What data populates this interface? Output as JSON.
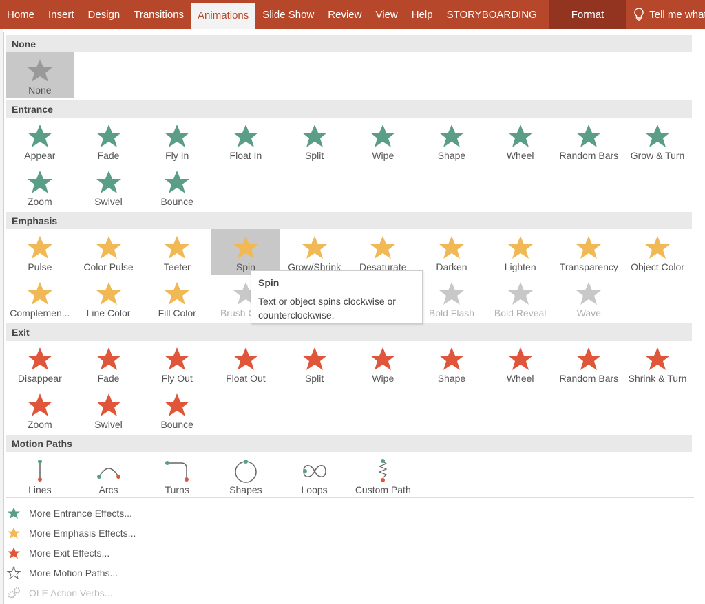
{
  "ribbon": {
    "tabs": [
      "Home",
      "Insert",
      "Design",
      "Transitions",
      "Animations",
      "Slide Show",
      "Review",
      "View",
      "Help",
      "STORYBOARDING"
    ],
    "active": "Animations",
    "format": "Format",
    "tell_me": "Tell me what",
    "color": "#b7472a"
  },
  "colors": {
    "none": "#999999",
    "entrance": "#5a9e87",
    "emphasis": "#f0b956",
    "exit": "#e0563b",
    "disabled": "#c8c8c8"
  },
  "sections": [
    {
      "title": "None",
      "kind": "none",
      "items": [
        {
          "label": "None",
          "selected": true
        }
      ]
    },
    {
      "title": "Entrance",
      "kind": "entrance",
      "items": [
        {
          "label": "Appear"
        },
        {
          "label": "Fade"
        },
        {
          "label": "Fly In"
        },
        {
          "label": "Float In"
        },
        {
          "label": "Split"
        },
        {
          "label": "Wipe"
        },
        {
          "label": "Shape"
        },
        {
          "label": "Wheel"
        },
        {
          "label": "Random Bars"
        },
        {
          "label": "Grow & Turn"
        },
        {
          "label": "Zoom"
        },
        {
          "label": "Swivel"
        },
        {
          "label": "Bounce"
        }
      ]
    },
    {
      "title": "Emphasis",
      "kind": "emphasis",
      "items": [
        {
          "label": "Pulse"
        },
        {
          "label": "Color Pulse"
        },
        {
          "label": "Teeter"
        },
        {
          "label": "Spin",
          "selected": true
        },
        {
          "label": "Grow/Shrink"
        },
        {
          "label": "Desaturate"
        },
        {
          "label": "Darken"
        },
        {
          "label": "Lighten"
        },
        {
          "label": "Transparency"
        },
        {
          "label": "Object Color"
        },
        {
          "label": "Complemen..."
        },
        {
          "label": "Line Color"
        },
        {
          "label": "Fill Color"
        },
        {
          "label": "Brush Color",
          "disabled": true
        },
        {
          "label": "",
          "hidden": true
        },
        {
          "label": "",
          "hidden": true
        },
        {
          "label": "Bold Flash",
          "disabled": true
        },
        {
          "label": "Bold Reveal",
          "disabled": true
        },
        {
          "label": "Wave",
          "disabled": true
        }
      ]
    },
    {
      "title": "Exit",
      "kind": "exit",
      "items": [
        {
          "label": "Disappear"
        },
        {
          "label": "Fade"
        },
        {
          "label": "Fly Out"
        },
        {
          "label": "Float Out"
        },
        {
          "label": "Split"
        },
        {
          "label": "Wipe"
        },
        {
          "label": "Shape"
        },
        {
          "label": "Wheel"
        },
        {
          "label": "Random Bars"
        },
        {
          "label": "Shrink & Turn"
        },
        {
          "label": "Zoom"
        },
        {
          "label": "Swivel"
        },
        {
          "label": "Bounce"
        }
      ]
    },
    {
      "title": "Motion Paths",
      "kind": "motion",
      "items": [
        {
          "label": "Lines",
          "icon": "line-path"
        },
        {
          "label": "Arcs",
          "icon": "arc-path"
        },
        {
          "label": "Turns",
          "icon": "turn-path"
        },
        {
          "label": "Shapes",
          "icon": "circle-path"
        },
        {
          "label": "Loops",
          "icon": "loop-path"
        },
        {
          "label": "Custom Path",
          "icon": "custom-path"
        }
      ]
    }
  ],
  "menu": [
    {
      "label": "More Entrance Effects...",
      "icon": "star-green"
    },
    {
      "label": "More Emphasis Effects...",
      "icon": "star-yellow"
    },
    {
      "label": "More Exit Effects...",
      "icon": "star-red"
    },
    {
      "label": "More Motion Paths...",
      "icon": "star-outline"
    },
    {
      "label": "OLE Action Verbs...",
      "icon": "gears",
      "disabled": true
    }
  ],
  "tooltip": {
    "title": "Spin",
    "text": "Text or object spins clockwise or counterclockwise."
  }
}
